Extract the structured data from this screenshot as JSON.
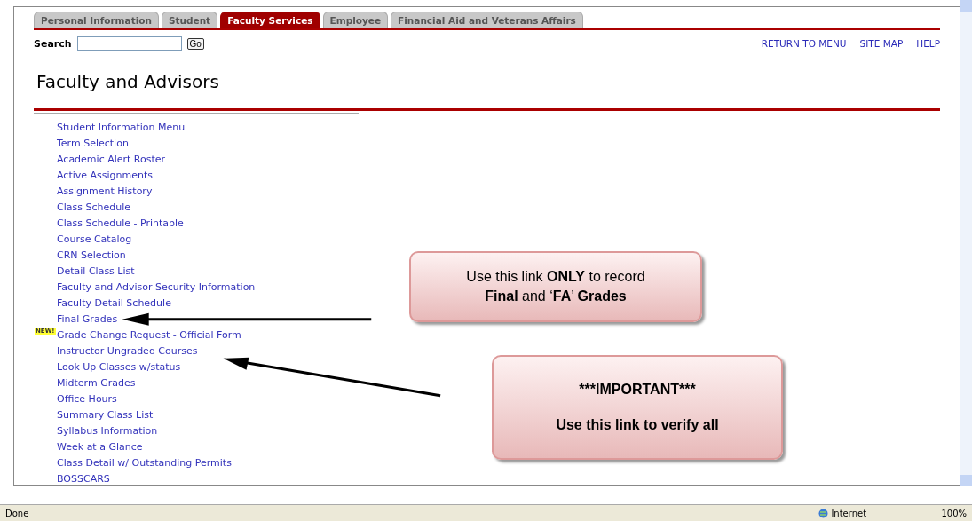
{
  "tabs": [
    {
      "label": "Personal Information",
      "selected": false
    },
    {
      "label": "Student",
      "selected": false
    },
    {
      "label": "Faculty Services",
      "selected": true
    },
    {
      "label": "Employee",
      "selected": false
    },
    {
      "label": "Financial Aid and Veterans Affairs",
      "selected": false
    }
  ],
  "search": {
    "label": "Search",
    "button": "Go"
  },
  "top_links": [
    "RETURN TO MENU",
    "SITE MAP",
    "HELP"
  ],
  "title": "Faculty and Advisors",
  "menu": [
    {
      "label": "Student Information Menu"
    },
    {
      "label": "Term Selection"
    },
    {
      "label": "Academic Alert Roster"
    },
    {
      "label": "Active Assignments"
    },
    {
      "label": "Assignment History"
    },
    {
      "label": "Class Schedule"
    },
    {
      "label": "Class Schedule - Printable"
    },
    {
      "label": "Course Catalog"
    },
    {
      "label": "CRN Selection"
    },
    {
      "label": "Detail Class List"
    },
    {
      "label": "Faculty and Advisor Security Information"
    },
    {
      "label": "Faculty Detail Schedule"
    },
    {
      "label": "Final Grades"
    },
    {
      "label": "Grade Change Request - Official Form",
      "badge": "NEW!"
    },
    {
      "label": "Instructor Ungraded Courses"
    },
    {
      "label": "Look Up Classes w/status"
    },
    {
      "label": "Midterm Grades"
    },
    {
      "label": "Office Hours"
    },
    {
      "label": "Summary Class List"
    },
    {
      "label": "Syllabus Information"
    },
    {
      "label": "Week at a Glance"
    },
    {
      "label": "Class Detail w/ Outstanding Permits"
    },
    {
      "label": "BOSSCARS"
    }
  ],
  "callouts": [
    {
      "lines": [
        {
          "kind": "rich",
          "text": "Use this link **ONLY** to record"
        },
        {
          "kind": "rich",
          "text": "**Final** and ‘**FA**’ **Grades**"
        }
      ]
    },
    {
      "lines": [
        {
          "kind": "bold",
          "text": "***IMPORTANT***"
        },
        {
          "kind": "bold",
          "text": "Use this link to verify all"
        }
      ]
    }
  ],
  "status_bar": {
    "text": "Done",
    "zone": "Internet",
    "zoom": "100%"
  }
}
